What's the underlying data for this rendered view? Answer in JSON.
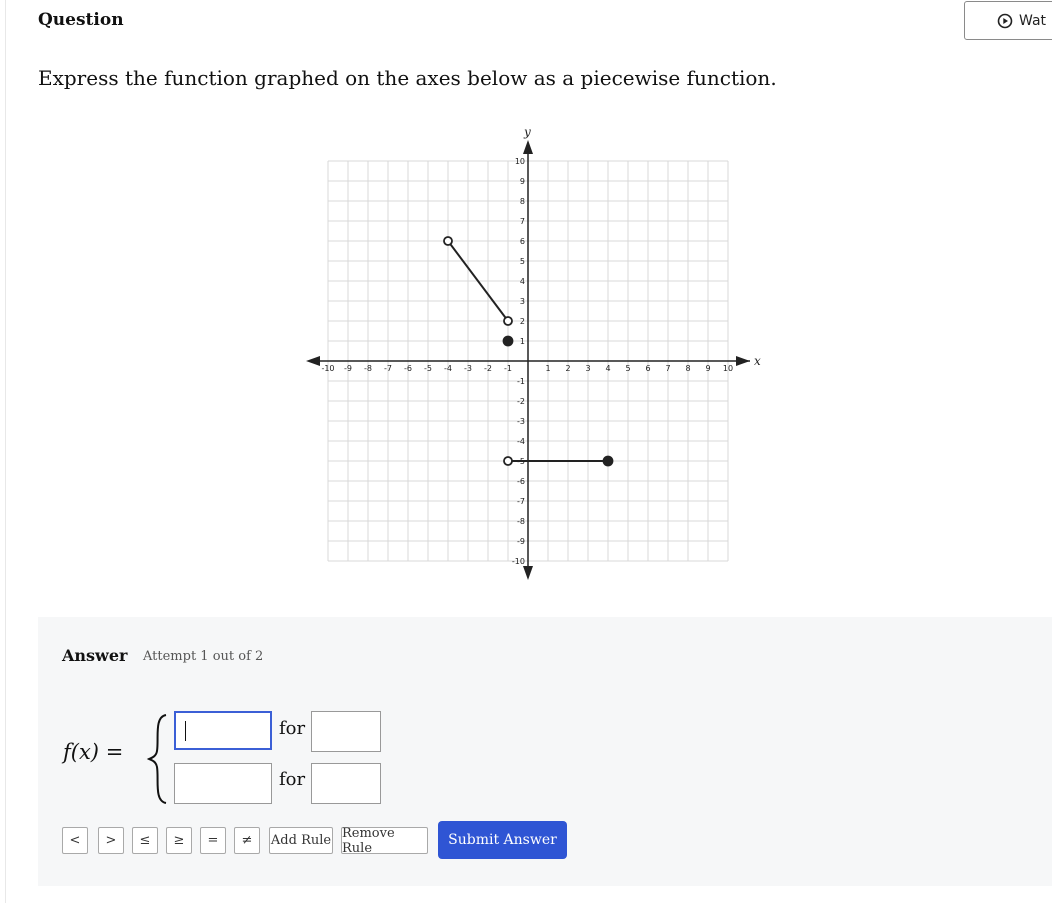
{
  "header": {
    "title": "Question",
    "watch_label": "Wat",
    "watch_icon": "play-circle-icon"
  },
  "question": {
    "text": "Express the function graphed on the axes below as a piecewise function."
  },
  "graph": {
    "x_label": "x",
    "y_label": "y",
    "x_range": [
      -10,
      10
    ],
    "y_range": [
      -10,
      10
    ],
    "x_ticks": [
      "-10",
      "-9",
      "-8",
      "-7",
      "-6",
      "-5",
      "-4",
      "-3",
      "-2",
      "-1",
      "1",
      "2",
      "3",
      "4",
      "5",
      "6",
      "7",
      "8",
      "9",
      "10"
    ],
    "y_ticks": [
      "10",
      "9",
      "8",
      "7",
      "6",
      "5",
      "4",
      "3",
      "2",
      "1",
      "-1",
      "-2",
      "-3",
      "-4",
      "-5",
      "-6",
      "-7",
      "-8",
      "-9",
      "-10"
    ],
    "segments": [
      {
        "from": [
          -4,
          6
        ],
        "to": [
          -1,
          2
        ],
        "from_closed": false,
        "to_closed": false
      },
      {
        "from": [
          -1,
          -5
        ],
        "to": [
          4,
          -5
        ],
        "from_closed": false,
        "to_closed": true
      }
    ],
    "points": [
      {
        "at": [
          -1,
          1
        ],
        "closed": true
      }
    ],
    "line_color": "#222222"
  },
  "answer": {
    "label": "Answer",
    "attempt": "Attempt 1 out of 2",
    "function_label": "f(x)",
    "equals": "=",
    "rows": [
      {
        "value": "",
        "connector": "for",
        "condition": ""
      },
      {
        "value": "",
        "connector": "for",
        "condition": ""
      }
    ],
    "toolbar": {
      "lt": "<",
      "gt": ">",
      "le": "≤",
      "ge": "≥",
      "eq": "=",
      "ne": "≠",
      "add_rule": "Add Rule",
      "remove_rule": "Remove Rule"
    },
    "submit_label": "Submit Answer",
    "accent_color": "#2f55d4"
  }
}
